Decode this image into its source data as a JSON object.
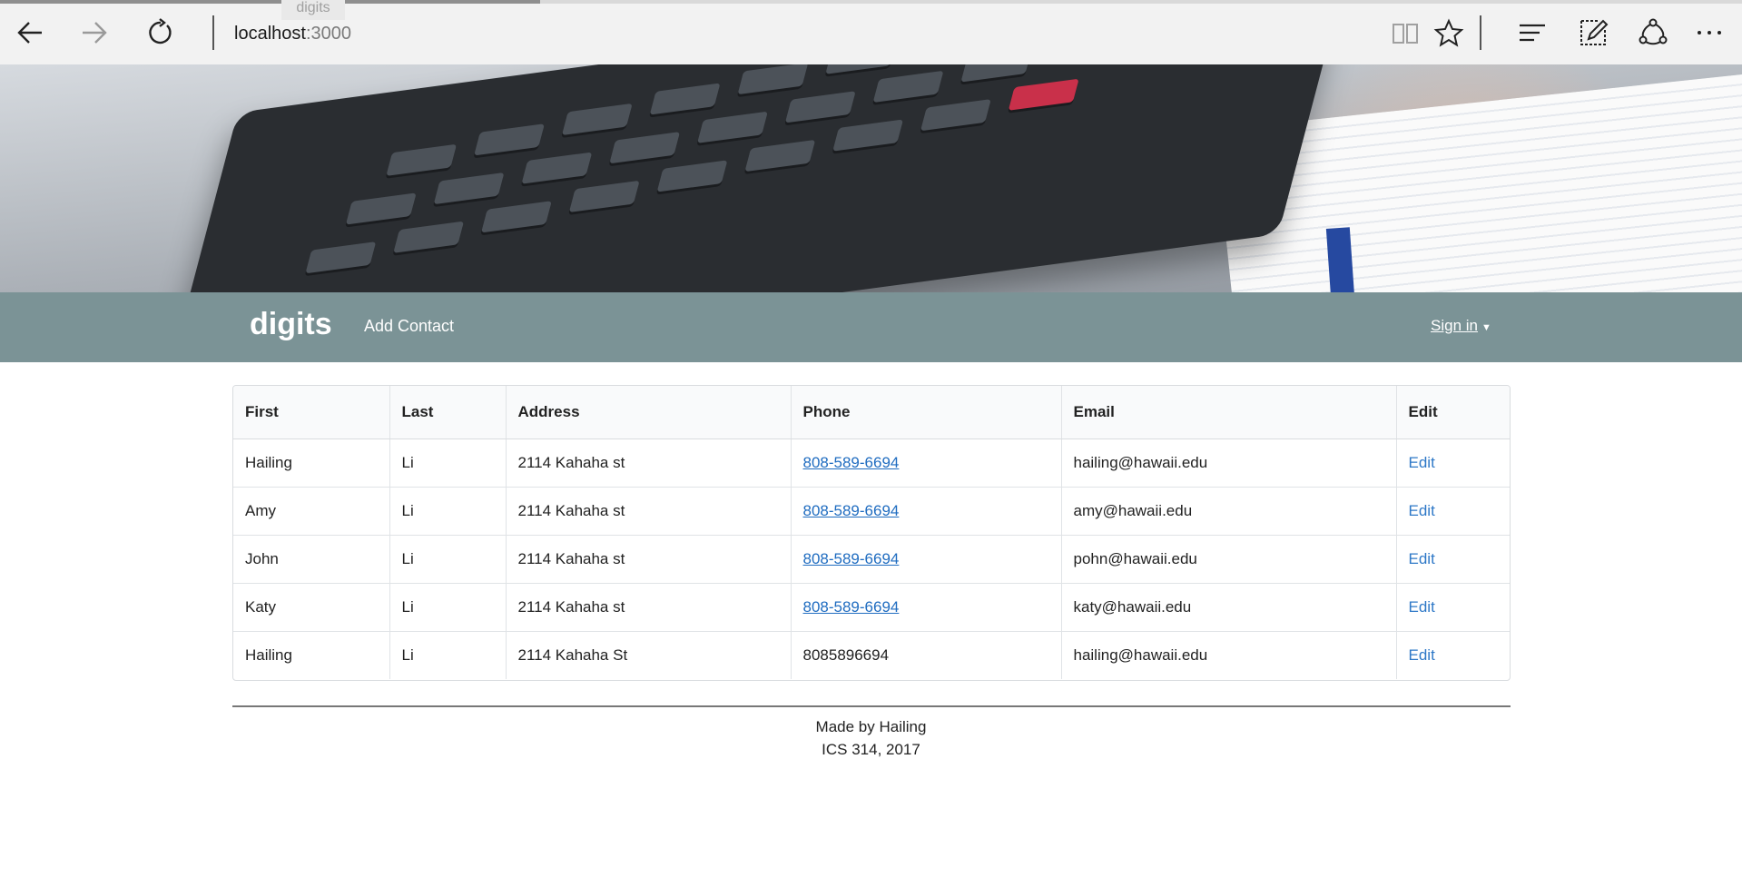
{
  "browser": {
    "tab_title": "digits",
    "address_host": "localhost",
    "address_port": ":3000",
    "icons": [
      "back-arrow-icon",
      "forward-arrow-icon",
      "refresh-icon",
      "reading-view-icon",
      "favorite-star-icon",
      "hub-icon",
      "web-note-icon",
      "share-icon",
      "more-icon"
    ]
  },
  "navbar": {
    "brand": "digits",
    "add_contact": "Add Contact",
    "sign_in": "Sign in",
    "caret": "▼",
    "color": "#7b9396"
  },
  "table": {
    "headers": [
      "First",
      "Last",
      "Address",
      "Phone",
      "Email",
      "Edit"
    ],
    "rows": [
      {
        "first": "Hailing",
        "last": "Li",
        "address": "2114 Kahaha st",
        "phone": "808-589-6694",
        "email": "hailing@hawaii.edu",
        "edit": "Edit"
      },
      {
        "first": "Amy",
        "last": "Li",
        "address": "2114 Kahaha st",
        "phone": "808-589-6694",
        "email": "amy@hawaii.edu",
        "edit": "Edit"
      },
      {
        "first": "John",
        "last": "Li",
        "address": "2114 Kahaha st",
        "phone": "808-589-6694",
        "email": "pohn@hawaii.edu",
        "edit": "Edit"
      },
      {
        "first": "Katy",
        "last": "Li",
        "address": "2114 Kahaha st",
        "phone": "808-589-6694",
        "email": "katy@hawaii.edu",
        "edit": "Edit"
      },
      {
        "first": "Hailing",
        "last": "Li",
        "address": "2114 Kahaha St",
        "phone": "8085896694",
        "email": "hailing@hawaii.edu",
        "edit": "Edit"
      }
    ]
  },
  "footer": {
    "line1": "Made by Hailing",
    "line2": "ICS 314, 2017"
  },
  "load_progress": 0.31
}
